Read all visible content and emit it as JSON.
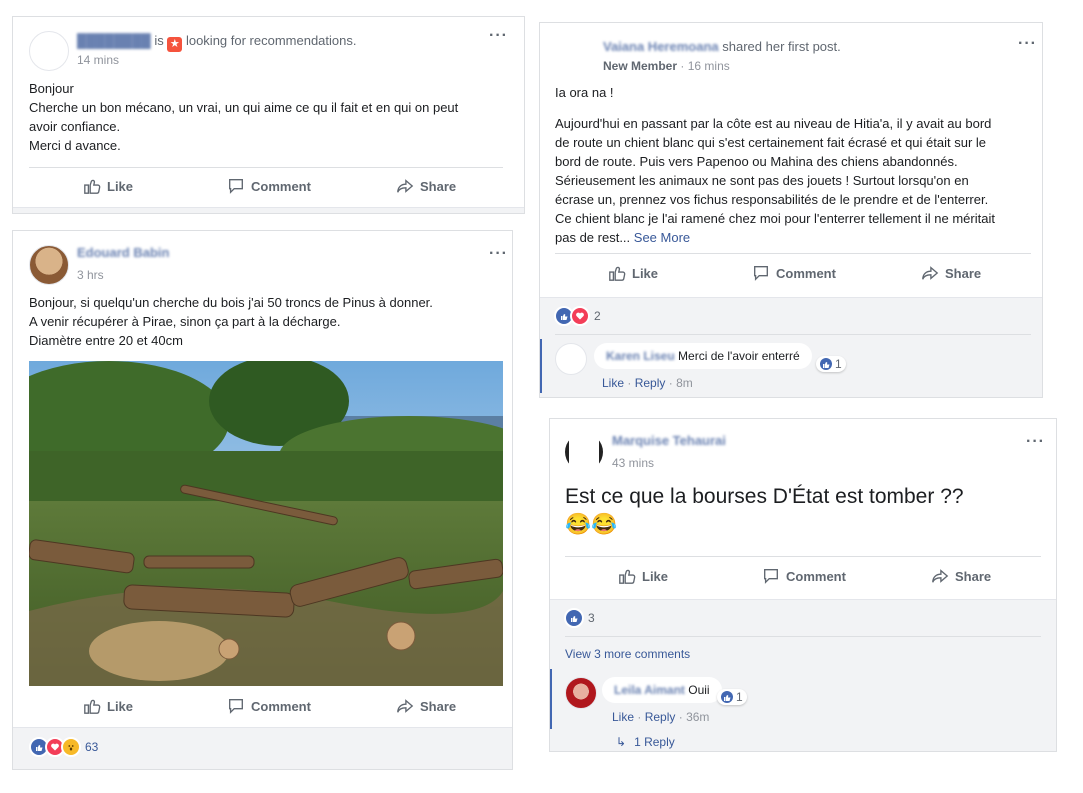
{
  "post1": {
    "status_prefix": "is",
    "status_text": "looking for recommendations.",
    "time": "14 mins",
    "lines": [
      "Bonjour",
      "Cherche un bon mécano, un vrai, un qui aime ce qu il fait et en qui on peut",
      "avoir confiance.",
      "Merci d avance."
    ]
  },
  "post2": {
    "author_blurred": "Edouard Babin",
    "time": "3 hrs",
    "lines": [
      "Bonjour, si quelqu'un cherche du bois j'ai 50 troncs de Pinus à donner.",
      "A venir récupérer à Pirae, sinon ça part à la décharge.",
      "Diamètre entre 20 et 40cm"
    ],
    "reaction_count": "63"
  },
  "post3": {
    "author_blurred": "Vaiana Heremoana",
    "shared_text": "shared her first post.",
    "badge": "New Member",
    "time": "16 mins",
    "greeting": "Ia ora na !",
    "lines": [
      "Aujourd'hui en passant par la côte est au niveau de Hitia'a, il y avait au bord",
      "de route un chient blanc qui s'est certainement fait écrasé et qui était sur le",
      "bord de route. Puis vers Papenoo ou Mahina des chiens abandonnés.",
      "Sérieusement les animaux ne sont pas des jouets ! Surtout lorsqu'on en",
      "écrase un, prennez vos fichus responsabilités de le prendre et de l'enterrer.",
      "Ce chient blanc je l'ai ramené chez moi pour l'enterrer tellement il ne méritait"
    ],
    "last_line": "pas de rest...",
    "see_more": "See More",
    "reaction_count": "2",
    "comment": {
      "author_blurred": "Karen Liseu",
      "text": "Merci de l'avoir enterré",
      "likes": "1",
      "like": "Like",
      "reply": "Reply",
      "time": "8m"
    }
  },
  "post4": {
    "author_blurred": "Marquise Tehaurai",
    "time": "43 mins",
    "text": "Est ce que la bourses D'État est tomber ??",
    "emoji": "😂😂",
    "reaction_count": "3",
    "view_more": "View 3 more comments",
    "comment": {
      "author_blurred": "Leila Aimant",
      "text": "Ouii",
      "likes": "1",
      "like": "Like",
      "reply": "Reply",
      "time": "36m"
    },
    "replies": "1 Reply"
  },
  "actions": {
    "like": "Like",
    "comment": "Comment",
    "share": "Share"
  },
  "colors": {
    "link": "#385898",
    "like_blue": "#4267b2",
    "love_red": "#f33e58",
    "bg": "#e9ebee"
  }
}
